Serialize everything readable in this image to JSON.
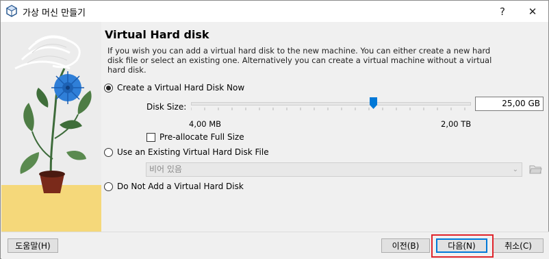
{
  "window": {
    "title": "가상 머신 만들기",
    "help_glyph": "?",
    "close_glyph": "✕"
  },
  "page": {
    "title": "Virtual Hard disk",
    "description": "If you wish you can add a virtual hard disk to the new machine. You can either create a new hard disk file or select an existing one. Alternatively you can create a virtual machine without a virtual hard disk."
  },
  "options": {
    "create_new": {
      "label": "Create a Virtual Hard Disk Now",
      "selected": true
    },
    "use_existing": {
      "label": "Use an Existing Virtual Hard Disk File",
      "selected": false
    },
    "do_not_add": {
      "label": "Do Not Add a Virtual Hard Disk",
      "selected": false
    }
  },
  "disk_size": {
    "label": "Disk Size:",
    "value": "25,00 GB",
    "slider_fraction": 0.65,
    "min_label": "4,00 MB",
    "max_label": "2,00 TB",
    "preallocate_label": "Pre-allocate Full Size",
    "preallocate_checked": false
  },
  "existing_file": {
    "combo_value": "비어 있음"
  },
  "buttons": {
    "help": "도움말(H)",
    "back": "이전(B)",
    "next": "다음(N)",
    "cancel": "취소(C)"
  },
  "colors": {
    "accent": "#0078d7",
    "highlight": "#e0242b",
    "flower": "#2f7fd8",
    "pot": "#7a2a1a",
    "ground": "#f5d87a"
  },
  "icons": {
    "app": "virtualbox-icon",
    "folder": "folder-open-icon"
  }
}
